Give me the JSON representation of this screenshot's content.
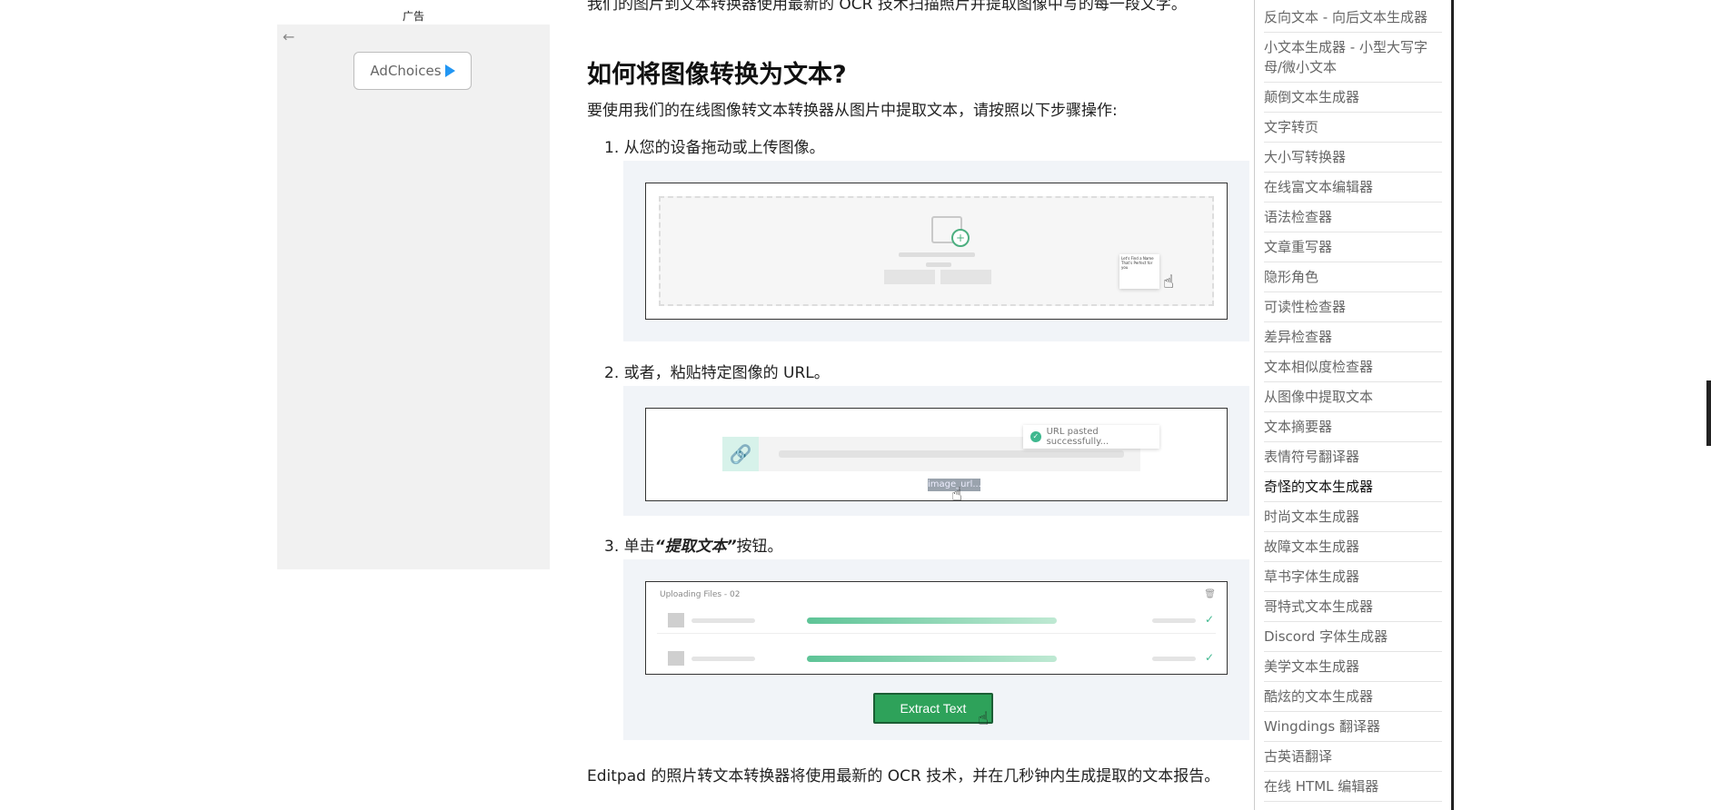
{
  "ad": {
    "label": "广告",
    "back_icon": "←",
    "adchoices_label": "AdChoices"
  },
  "content": {
    "top_cut_text": "我们的图片到文本转换器使用最新的 OCR 技术扫描照片并提取图像中写的每一段文字。",
    "heading": "如何将图像转换为文本?",
    "intro": "要使用我们的在线图像转文本转换器从图片中提取文本，请按照以下步骤操作:",
    "steps": [
      {
        "num": "1.",
        "text": "从您的设备拖动或上传图像。"
      },
      {
        "num": "2.",
        "text": "或者，粘贴特定图像的 URL。"
      },
      {
        "num": "3.",
        "prefix": "单击",
        "bold": "“提取文本”",
        "suffix": "按钮。"
      }
    ],
    "illustration_1": {
      "card_title": "Let's Find a Name That's Perfect for you"
    },
    "illustration_2": {
      "toast": "URL pasted successfully...",
      "chip": "image_url..."
    },
    "illustration_3": {
      "title": "Uploading Files - 02",
      "rows": [
        {
          "progress": 1.0
        },
        {
          "progress": 1.0
        }
      ],
      "button_label": "Extract Text"
    },
    "footer": "Editpad 的照片转文本转换器将使用最新的 OCR 技术，并在几秒钟内生成提取的文本报告。"
  },
  "sidebar": {
    "items": [
      {
        "label": "反向文本 - 向后文本生成器"
      },
      {
        "label": "小文本生成器 - 小型大写字母/微小文本"
      },
      {
        "label": "颠倒文本生成器"
      },
      {
        "label": "文字转页"
      },
      {
        "label": "大小写转换器"
      },
      {
        "label": "在线富文本编辑器"
      },
      {
        "label": "语法检查器"
      },
      {
        "label": "文章重写器"
      },
      {
        "label": "隐形角色"
      },
      {
        "label": "可读性检查器"
      },
      {
        "label": "差异检查器"
      },
      {
        "label": "文本相似度检查器"
      },
      {
        "label": "从图像中提取文本"
      },
      {
        "label": "文本摘要器"
      },
      {
        "label": "表情符号翻译器"
      },
      {
        "label": "奇怪的文本生成器",
        "active": true
      },
      {
        "label": "时尚文本生成器"
      },
      {
        "label": "故障文本生成器"
      },
      {
        "label": "草书字体生成器"
      },
      {
        "label": "哥特式文本生成器"
      },
      {
        "label": "Discord 字体生成器"
      },
      {
        "label": "美学文本生成器"
      },
      {
        "label": "酷炫的文本生成器"
      },
      {
        "label": "Wingdings 翻译器"
      },
      {
        "label": "古英语翻译"
      },
      {
        "label": "在线 HTML 编辑器"
      }
    ]
  }
}
